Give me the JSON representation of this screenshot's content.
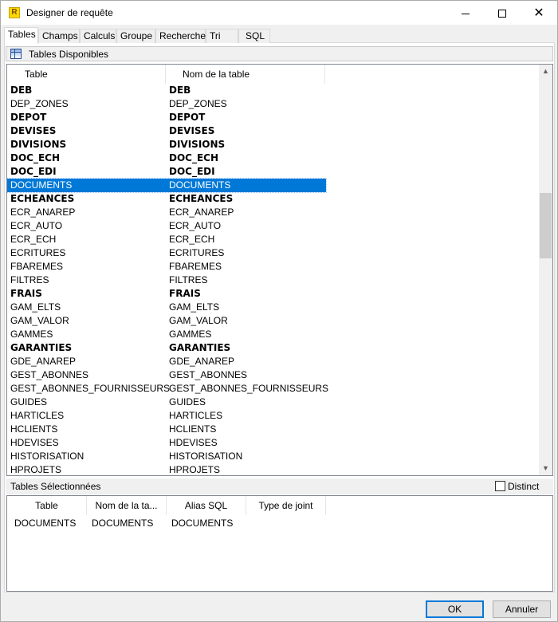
{
  "window": {
    "title": "Designer de requête"
  },
  "tabs": [
    "Tables",
    "Champs",
    "Calculs",
    "Groupe",
    "Recherche",
    "Tri",
    "SQL"
  ],
  "available": {
    "title": "Tables Disponibles",
    "columns": [
      "Table",
      "Nom de la table"
    ],
    "rows": [
      {
        "table": "DEB",
        "name": "DEB",
        "bold": true
      },
      {
        "table": "DEP_ZONES",
        "name": "DEP_ZONES",
        "bold": false
      },
      {
        "table": "DEPOT",
        "name": "DEPOT",
        "bold": true
      },
      {
        "table": "DEVISES",
        "name": "DEVISES",
        "bold": true
      },
      {
        "table": "DIVISIONS",
        "name": "DIVISIONS",
        "bold": true
      },
      {
        "table": "DOC_ECH",
        "name": "DOC_ECH",
        "bold": true
      },
      {
        "table": "DOC_EDI",
        "name": "DOC_EDI",
        "bold": true
      },
      {
        "table": "DOCUMENTS",
        "name": "DOCUMENTS",
        "bold": false,
        "selected": true
      },
      {
        "table": "ECHEANCES",
        "name": "ECHEANCES",
        "bold": true
      },
      {
        "table": "ECR_ANAREP",
        "name": "ECR_ANAREP",
        "bold": false
      },
      {
        "table": "ECR_AUTO",
        "name": "ECR_AUTO",
        "bold": false
      },
      {
        "table": "ECR_ECH",
        "name": "ECR_ECH",
        "bold": false
      },
      {
        "table": "ECRITURES",
        "name": "ECRITURES",
        "bold": false
      },
      {
        "table": "FBAREMES",
        "name": "FBAREMES",
        "bold": false
      },
      {
        "table": "FILTRES",
        "name": "FILTRES",
        "bold": false
      },
      {
        "table": "FRAIS",
        "name": "FRAIS",
        "bold": true
      },
      {
        "table": "GAM_ELTS",
        "name": "GAM_ELTS",
        "bold": false
      },
      {
        "table": "GAM_VALOR",
        "name": "GAM_VALOR",
        "bold": false
      },
      {
        "table": "GAMMES",
        "name": "GAMMES",
        "bold": false
      },
      {
        "table": "GARANTIES",
        "name": "GARANTIES",
        "bold": true
      },
      {
        "table": "GDE_ANAREP",
        "name": "GDE_ANAREP",
        "bold": false
      },
      {
        "table": "GEST_ABONNES",
        "name": "GEST_ABONNES",
        "bold": false
      },
      {
        "table": "GEST_ABONNES_FOURNISSEURS",
        "name": "GEST_ABONNES_FOURNISSEURS",
        "bold": false
      },
      {
        "table": "GUIDES",
        "name": "GUIDES",
        "bold": false
      },
      {
        "table": "HARTICLES",
        "name": "HARTICLES",
        "bold": false
      },
      {
        "table": "HCLIENTS",
        "name": "HCLIENTS",
        "bold": false
      },
      {
        "table": "HDEVISES",
        "name": "HDEVISES",
        "bold": false
      },
      {
        "table": "HISTORISATION",
        "name": "HISTORISATION",
        "bold": false
      },
      {
        "table": "HPROJETS",
        "name": "HPROJETS",
        "bold": false
      }
    ]
  },
  "selected_tables": {
    "title": "Tables Sélectionnées",
    "distinct_label": "Distinct",
    "distinct_checked": false,
    "columns": [
      "Table",
      "Nom de la ta...",
      "Alias SQL",
      "Type de joint"
    ],
    "rows": [
      {
        "table": "DOCUMENTS",
        "name": "DOCUMENTS",
        "alias": "DOCUMENTS",
        "join": ""
      }
    ]
  },
  "buttons": {
    "ok": "OK",
    "cancel": "Annuler"
  },
  "colors": {
    "selection": "#0078d7",
    "ok_border": "#0078d7"
  },
  "icons": {
    "app": "query-designer-icon",
    "group": "tables-icon"
  }
}
